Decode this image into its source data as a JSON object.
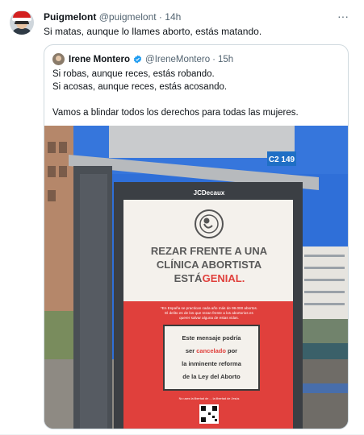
{
  "tweet": {
    "author_name": "Puigmelont",
    "author_handle": "@puigmelont",
    "separator": "·",
    "time": "14h",
    "more_label": "···",
    "text": "Si matas, aunque lo llames aborto, estás matando."
  },
  "quoted": {
    "author_name": "Irene Montero",
    "author_handle": "@IreneMontero",
    "separator": "·",
    "time": "15h",
    "lines": [
      "Si robas, aunque reces, estás robando.",
      "Si acosas, aunque reces, estás acosando.",
      "",
      "Vamos a blindar todos los derechos para todas las mujeres."
    ]
  },
  "photo": {
    "bus_stop_sign": "C2 149",
    "shelter_brand": "JCDecaux",
    "poster": {
      "headline_1": "REZAR FRENTE A UNA",
      "headline_2": "CLÍNICA ABORTISTA",
      "headline_3": "ESTÁ",
      "headline_highlight": "GENIAL.",
      "footnote_1": "*En España se practican cada año más de 99.000 abortos.",
      "footnote_2": "El delito es de los que rezan frente a los abortorios es",
      "footnote_3": "querer salvar alguna de estas vidas.",
      "box_1": "Este mensaje podría",
      "box_2_prefix": "ser",
      "box_2_highlight": "cancelado",
      "box_2_suffix": "por",
      "box_3": "la inminente reforma",
      "box_4": "de la Ley del Aborto",
      "bottom_text": "No uses la libertad de ... la libertad de Jesús"
    },
    "colors": {
      "poster_red": "#e0403c",
      "poster_white": "#f4f1ec",
      "sky": "#2f6fd8",
      "shelter_frame": "#3b3f44"
    }
  }
}
